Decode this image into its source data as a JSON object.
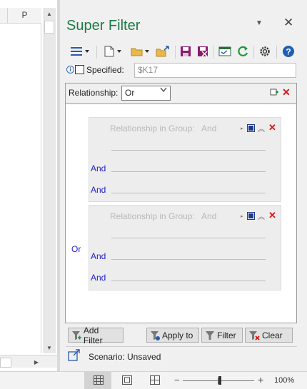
{
  "sheet": {
    "column_header": "P"
  },
  "panel": {
    "title": "Super Filter",
    "menu_icon": "dropdown-triangle-icon",
    "close_glyph": "✕",
    "toolbar_icons": [
      "hamburger-menu-icon",
      "new-file-icon",
      "open-folder-icon",
      "import-icon",
      "save-icon",
      "save-as-icon",
      "window-icon",
      "refresh-icon",
      "settings-icon",
      "help-icon"
    ],
    "brand_color": "#1b7a44"
  },
  "specified": {
    "label": "Specified:",
    "value": "$K17",
    "checked": false
  },
  "relationship": {
    "label": "Relationship:",
    "selected": "Or"
  },
  "groups": [
    {
      "title": "Relationship in Group:",
      "value": "And",
      "rows": [
        "And",
        "And"
      ]
    },
    {
      "title": "Relationship in Group:",
      "value": "And",
      "rows": [
        "And",
        "And"
      ]
    }
  ],
  "outer_relationship": "Or",
  "buttons": {
    "add_filter": "Add Filter",
    "apply_to": "Apply to",
    "filter": "Filter",
    "clear": "Clear"
  },
  "scenario": {
    "label": "Scenario:",
    "value": "Unsaved"
  },
  "statusbar": {
    "zoom": "100%",
    "zoom_level": 100,
    "minus": "−",
    "plus": "+"
  }
}
